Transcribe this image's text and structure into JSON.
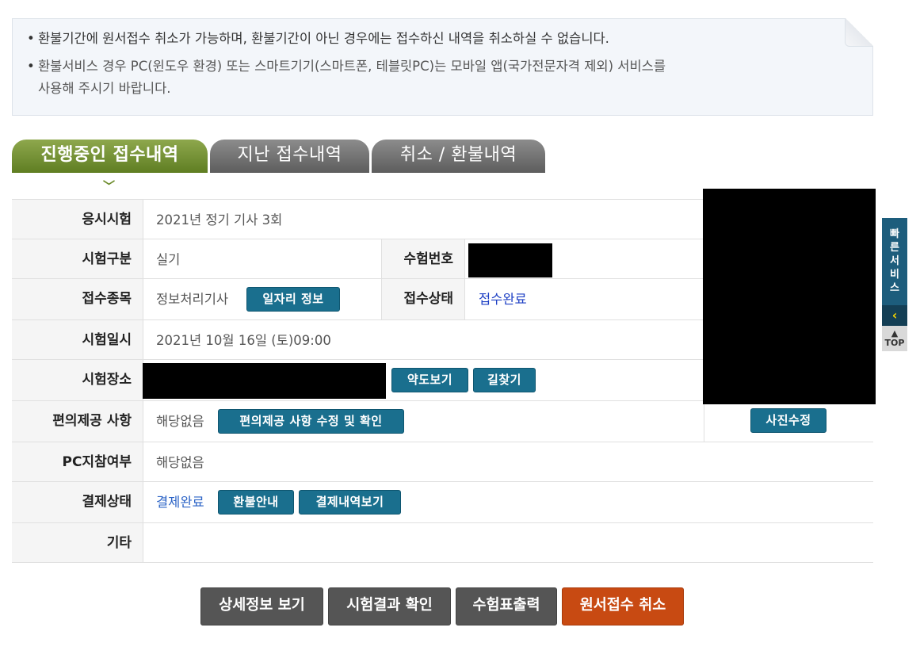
{
  "notice": {
    "line1": "환불기간에 원서접수 취소가 가능하며, 환불기간이 아닌 경우에는 접수하신 내역을 취소하실 수 없습니다.",
    "line2a": "환불서비스 경우 PC(윈도우 환경) 또는 스마트기기(스마트폰, 테블릿PC)는 모바일 앱(국가전문자격 제외) 서비스를",
    "line2b": "사용해 주시기 바랍니다."
  },
  "tabs": [
    {
      "label": "진행중인 접수내역",
      "active": true
    },
    {
      "label": "지난 접수내역",
      "active": false
    },
    {
      "label": "취소 / 환불내역",
      "active": false
    }
  ],
  "rows": {
    "exam": {
      "label": "응시시험",
      "value": "2021년 정기 기사 3회"
    },
    "category": {
      "label": "시험구분",
      "value": "실기"
    },
    "exam_number": {
      "label": "수험번호"
    },
    "subject": {
      "label": "접수종목",
      "value": "정보처리기사",
      "button": "일자리 정보"
    },
    "status": {
      "label": "접수상태",
      "value": "접수완료"
    },
    "date": {
      "label": "시험일시",
      "value": "2021년 10월 16일 (토)09:00"
    },
    "place": {
      "label": "시험장소",
      "map_button": "약도보기",
      "route_button": "길찾기"
    },
    "convenience": {
      "label": "편의제공 사항",
      "value": "해당없음",
      "button": "편의제공 사항 수정 및 확인"
    },
    "pc": {
      "label": "PC지참여부",
      "value": "해당없음"
    },
    "payment": {
      "label": "결제상태",
      "value": "결제완료",
      "refund_button": "환불안내",
      "history_button": "결제내역보기"
    },
    "etc": {
      "label": "기타",
      "value": ""
    }
  },
  "photo_button": "사진수정",
  "quick": {
    "label": "빠른서비스",
    "top": "TOP"
  },
  "bottom_buttons": {
    "detail": "상세정보 보기",
    "result": "시험결과 확인",
    "ticket": "수험표출력",
    "cancel": "원서접수 취소"
  },
  "colors": {
    "accent_green": "#6a8a28",
    "button_blue": "#1a6f8e",
    "cancel_red": "#c84a12",
    "link_blue": "#1d3fc4"
  }
}
